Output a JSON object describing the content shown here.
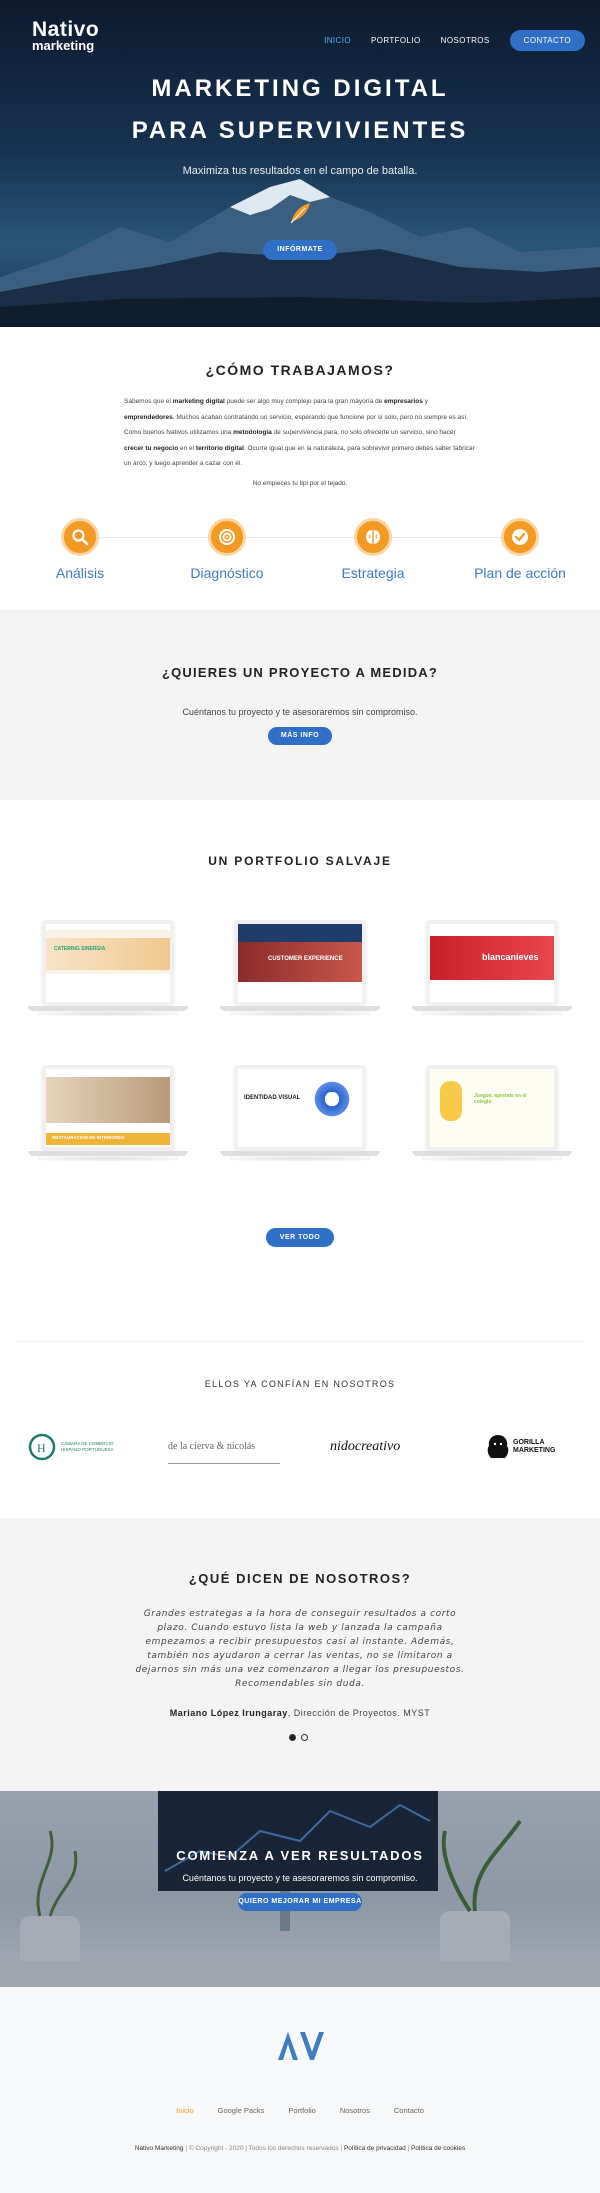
{
  "header": {
    "logo_line1": "Nativo",
    "logo_line2": "marketing",
    "nav": [
      "INICIO",
      "PORTFOLIO",
      "NOSOTROS"
    ],
    "contact": "CONTACTO"
  },
  "hero": {
    "title_line1": "MARKETING DIGITAL",
    "title_line2": "PARA SUPERVIVIENTES",
    "subtitle": "Maximiza tus resultados en el campo de batalla.",
    "cta": "INFÓRMATE"
  },
  "work": {
    "title": "¿CÓMO TRABAJAMOS?",
    "p_a": "Sabemos que el ",
    "p_b": "marketing digital",
    "p_c": " puede ser algo muy complejo para la gran mayoría de ",
    "p_d": "empresarios",
    "p_e": " y ",
    "p_f": "emprendedores",
    "p_g": ". Muchos acaban contratando un servicio, esperando que funcione por sí solo, pero no siempre es así. Como buenos Nativos utilizamos una ",
    "p_h": "metodología",
    "p_i": " de supervivencia para, no solo ofrecerte un servicio, sino hacer ",
    "p_j": "crecer tu negocio",
    "p_k": " en el ",
    "p_l": "territorio digital",
    "p_m": ". Ocurre igual que en la naturaleza, para sobrevivir primero debes saber fabricar un arco, y luego aprender a cazar con él.",
    "line2": "No empieces tu tipi por el tejado.",
    "steps": [
      "Análisis",
      "Diagnóstico",
      "Estrategia",
      "Plan de acción"
    ]
  },
  "project": {
    "title": "¿QUIERES UN PROYECTO A MEDIDA?",
    "subtitle": "Cuéntanos tu proyecto y te asesoraremos sin compromiso.",
    "button": "MÁS INFO"
  },
  "portfolio": {
    "title": "UN PORTFOLIO SALVAJE",
    "items": [
      {
        "text": "CATERING SINERGIA",
        "accent": "#2e9e6e"
      },
      {
        "text": "CUSTOMER EXPERIENCE",
        "accent": "#b63a3a"
      },
      {
        "text": "blancanieves",
        "accent": "#d8343a"
      },
      {
        "text": "RESTAURACIÓN DE INTERIORES",
        "accent": "#f0b43a"
      },
      {
        "text": "IDENTIDAD VISUAL",
        "accent": "#2a63c9"
      },
      {
        "text": "Juegos, aprende en el colegio",
        "accent": "#8cc63f"
      }
    ],
    "button": "VER TODO"
  },
  "clients": {
    "title": "ELLOS YA CONFÍAN EN NOSOTROS",
    "logos": [
      "CÁMARA DE COMERCIO HISPANO PORTUGUESA",
      "de la cierva & nicolás",
      "nidocreativo",
      "GORILLA MARKETING"
    ]
  },
  "testimonials": {
    "title": "¿QUÉ DICEN DE NOSOTROS?",
    "quote": "Grandes estrategas a la hora de conseguir resultados a corto plazo. Cuando estuvo lista la web y lanzada la campaña empezamos a recibir presupuestos casi al instante. Además, también nos ayudaron a cerrar las ventas, no se limitaron a dejarnos sin más una vez comenzaron a llegar los presupuestos. Recomendables sin duda.",
    "author": "Mariano López Irungaray",
    "role": ", Dirección de Proyectos. MYST"
  },
  "results": {
    "title": "COMIENZA A VER RESULTADOS",
    "subtitle": "Cuéntanos tu proyecto y te asesoraremos sin compromiso.",
    "button": "QUIERO MEJORAR MI EMPRESA"
  },
  "footer": {
    "links": [
      "Inicio",
      "Google Packs",
      "Portfolio",
      "Nosotros",
      "Contacto"
    ],
    "brand": "Nativo Marketing",
    "copy": " | © Copyright - 2020 | Todos los derechos reservados | ",
    "privacy": "Política de privacidad",
    "sep": " | ",
    "cookies": "Política de cookies"
  },
  "colors": {
    "accent": "#2f6fc5",
    "orange": "#f39a25",
    "step_label": "#3e7cc4"
  }
}
